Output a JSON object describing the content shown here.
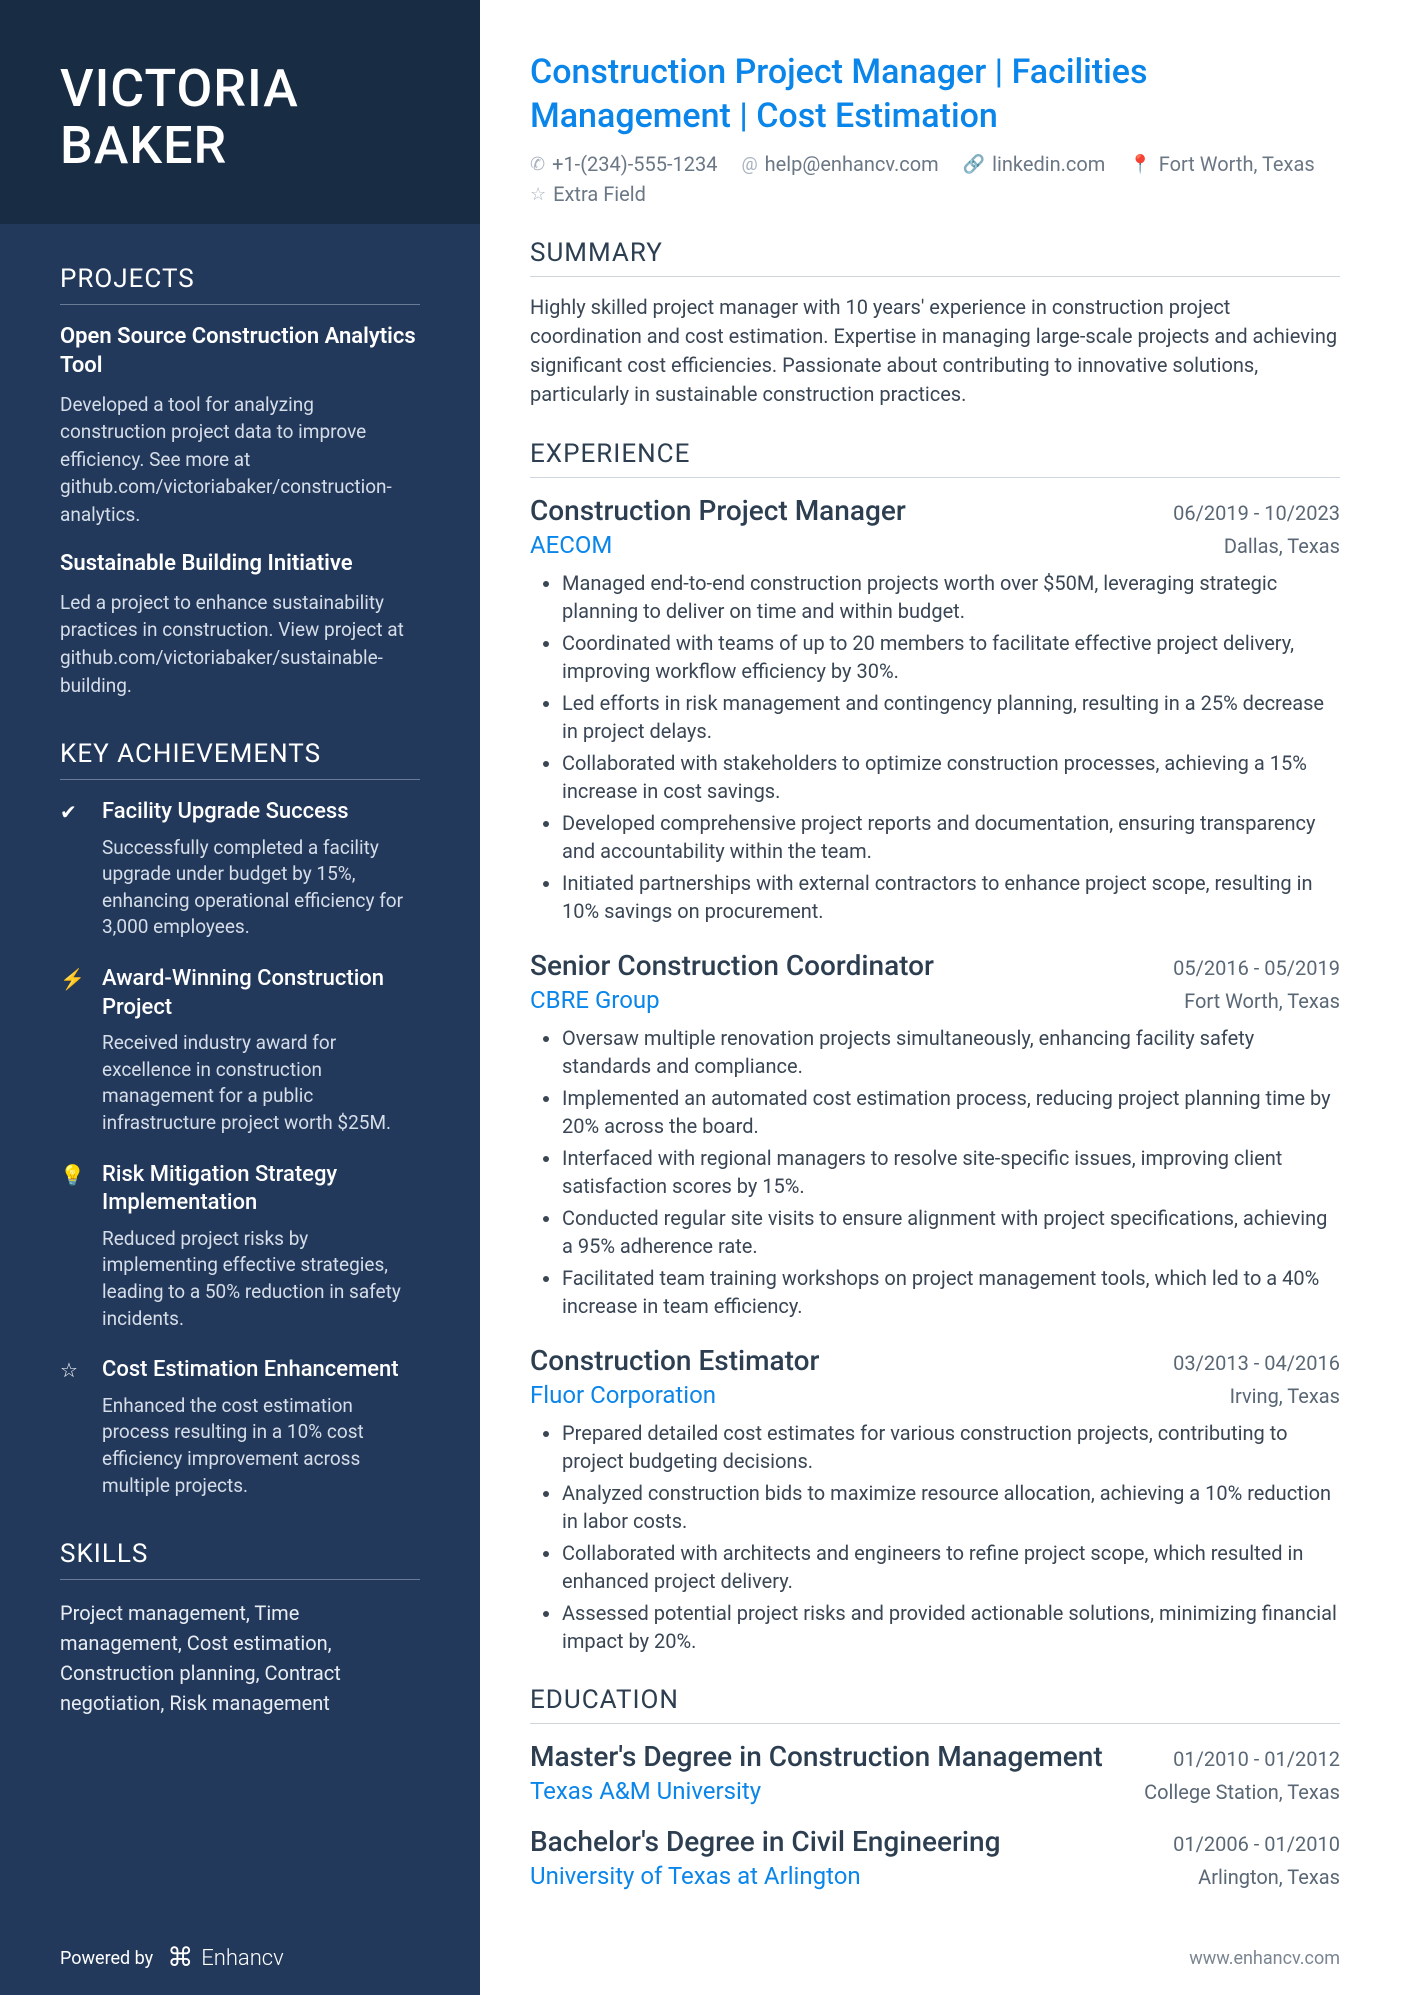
{
  "name": {
    "first": "VICTORIA",
    "last": "BAKER"
  },
  "headline": "Construction Project Manager | Facilities Management | Cost Estimation",
  "contacts": {
    "phone": "+1-(234)-555-1234",
    "email": "help@enhancv.com",
    "link": "linkedin.com",
    "location": "Fort Worth, Texas",
    "extra": "Extra Field"
  },
  "sections": {
    "projects": "PROJECTS",
    "achievements": "KEY ACHIEVEMENTS",
    "skills": "SKILLS",
    "summary": "SUMMARY",
    "experience": "EXPERIENCE",
    "education": "EDUCATION"
  },
  "projects": [
    {
      "title": "Open Source Construction Analytics Tool",
      "desc": "Developed a tool for analyzing construction project data to improve efficiency. See more at github.com/victoriabaker/construction-analytics."
    },
    {
      "title": "Sustainable Building Initiative",
      "desc": "Led a project to enhance sustainability practices in construction. View project at github.com/victoriabaker/sustainable-building."
    }
  ],
  "achievements": [
    {
      "icon": "✔",
      "title": "Facility Upgrade Success",
      "desc": "Successfully completed a facility upgrade under budget by 15%, enhancing operational efficiency for 3,000 employees."
    },
    {
      "icon": "⚡",
      "title": "Award-Winning Construction Project",
      "desc": "Received industry award for excellence in construction management for a public infrastructure project worth $25M."
    },
    {
      "icon": "💡",
      "title": "Risk Mitigation Strategy Implementation",
      "desc": "Reduced project risks by implementing effective strategies, leading to a 50% reduction in safety incidents."
    },
    {
      "icon": "☆",
      "title": "Cost Estimation Enhancement",
      "desc": "Enhanced the cost estimation process resulting in a 10% cost efficiency improvement across multiple projects."
    }
  ],
  "skills": "Project management, Time management, Cost estimation, Construction planning, Contract negotiation, Risk management",
  "summary": "Highly skilled project manager with 10 years' experience in construction project coordination and cost estimation. Expertise in managing large-scale projects and achieving significant cost efficiencies. Passionate about contributing to innovative solutions, particularly in sustainable construction practices.",
  "experience": [
    {
      "title": "Construction Project Manager",
      "dates": "06/2019 - 10/2023",
      "company": "AECOM",
      "location": "Dallas, Texas",
      "bullets": [
        "Managed end-to-end construction projects worth over $50M, leveraging strategic planning to deliver on time and within budget.",
        "Coordinated with teams of up to 20 members to facilitate effective project delivery, improving workflow efficiency by 30%.",
        "Led efforts in risk management and contingency planning, resulting in a 25% decrease in project delays.",
        "Collaborated with stakeholders to optimize construction processes, achieving a 15% increase in cost savings.",
        "Developed comprehensive project reports and documentation, ensuring transparency and accountability within the team.",
        "Initiated partnerships with external contractors to enhance project scope, resulting in 10% savings on procurement."
      ]
    },
    {
      "title": "Senior Construction Coordinator",
      "dates": "05/2016 - 05/2019",
      "company": "CBRE Group",
      "location": "Fort Worth, Texas",
      "bullets": [
        "Oversaw multiple renovation projects simultaneously, enhancing facility safety standards and compliance.",
        "Implemented an automated cost estimation process, reducing project planning time by 20% across the board.",
        "Interfaced with regional managers to resolve site-specific issues, improving client satisfaction scores by 15%.",
        "Conducted regular site visits to ensure alignment with project specifications, achieving a 95% adherence rate.",
        "Facilitated team training workshops on project management tools, which led to a 40% increase in team efficiency."
      ]
    },
    {
      "title": "Construction Estimator",
      "dates": "03/2013 - 04/2016",
      "company": "Fluor Corporation",
      "location": "Irving, Texas",
      "bullets": [
        "Prepared detailed cost estimates for various construction projects, contributing to project budgeting decisions.",
        "Analyzed construction bids to maximize resource allocation, achieving a 10% reduction in labor costs.",
        "Collaborated with architects and engineers to refine project scope, which resulted in enhanced project delivery.",
        "Assessed potential project risks and provided actionable solutions, minimizing financial impact by 20%."
      ]
    }
  ],
  "education": [
    {
      "degree": "Master's Degree in Construction Management",
      "dates": "01/2010 - 01/2012",
      "school": "Texas A&M University",
      "location": "College Station, Texas"
    },
    {
      "degree": "Bachelor's Degree in Civil Engineering",
      "dates": "01/2006 - 01/2010",
      "school": "University of Texas at Arlington",
      "location": "Arlington, Texas"
    }
  ],
  "footer": {
    "powered": "Powered by",
    "brand": "Enhancv",
    "url": "www.enhancv.com"
  }
}
